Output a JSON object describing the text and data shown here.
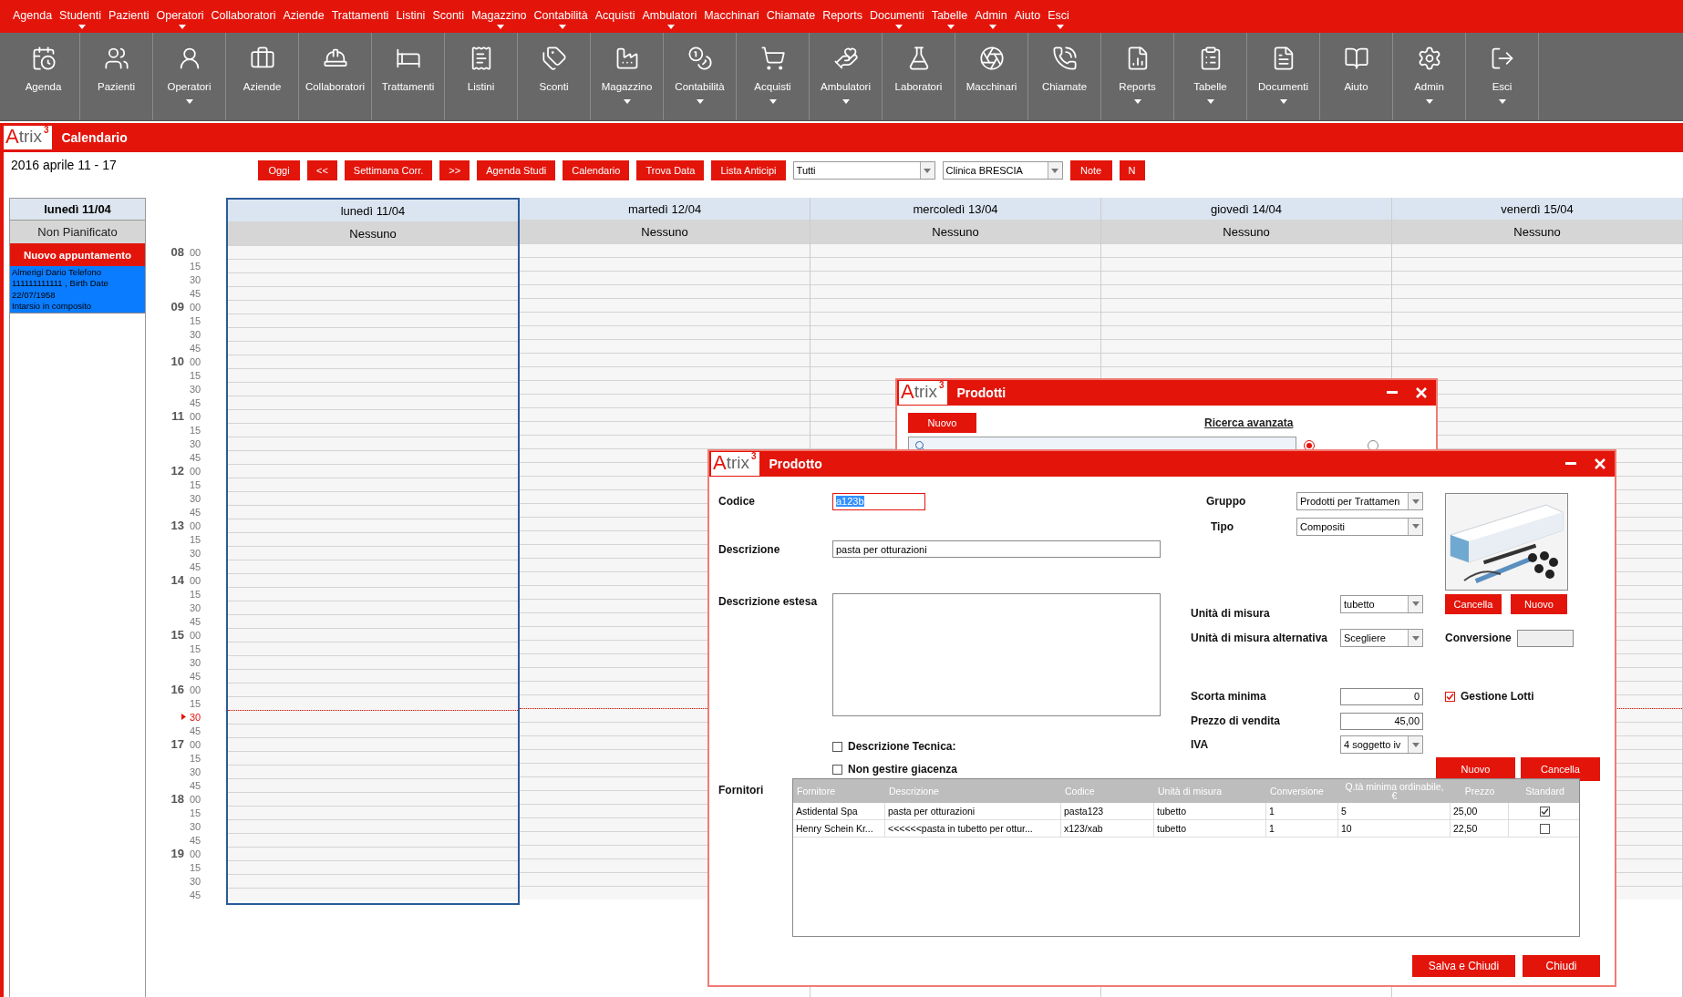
{
  "menu_bar": [
    {
      "label": "Agenda",
      "has_submenu": false
    },
    {
      "label": "Studenti",
      "has_submenu": true
    },
    {
      "label": "Pazienti",
      "has_submenu": false
    },
    {
      "label": "Operatori",
      "has_submenu": true
    },
    {
      "label": "Collaboratori",
      "has_submenu": false
    },
    {
      "label": "Aziende",
      "has_submenu": false
    },
    {
      "label": "Trattamenti",
      "has_submenu": false
    },
    {
      "label": "Listini",
      "has_submenu": false
    },
    {
      "label": "Sconti",
      "has_submenu": false
    },
    {
      "label": "Magazzino",
      "has_submenu": true
    },
    {
      "label": "Contabilità",
      "has_submenu": true
    },
    {
      "label": "Acquisti",
      "has_submenu": false
    },
    {
      "label": "Ambulatori",
      "has_submenu": true
    },
    {
      "label": "Macchinari",
      "has_submenu": false
    },
    {
      "label": "Chiamate",
      "has_submenu": false
    },
    {
      "label": "Reports",
      "has_submenu": false
    },
    {
      "label": "Documenti",
      "has_submenu": true
    },
    {
      "label": "Tabelle",
      "has_submenu": true
    },
    {
      "label": "Admin",
      "has_submenu": true
    },
    {
      "label": "Aiuto",
      "has_submenu": false
    },
    {
      "label": "Esci",
      "has_submenu": true
    }
  ],
  "toolbar": [
    {
      "label": "Agenda",
      "has_submenu": false
    },
    {
      "label": "Pazienti",
      "has_submenu": false
    },
    {
      "label": "Operatori",
      "has_submenu": true
    },
    {
      "label": "Aziende",
      "has_submenu": false
    },
    {
      "label": "Collaboratori",
      "has_submenu": false
    },
    {
      "label": "Trattamenti",
      "has_submenu": false
    },
    {
      "label": "Listini",
      "has_submenu": false
    },
    {
      "label": "Sconti",
      "has_submenu": false
    },
    {
      "label": "Magazzino",
      "has_submenu": true
    },
    {
      "label": "Contabilità",
      "has_submenu": true
    },
    {
      "label": "Acquisti",
      "has_submenu": true
    },
    {
      "label": "Ambulatori",
      "has_submenu": true
    },
    {
      "label": "Laboratori",
      "has_submenu": false
    },
    {
      "label": "Macchinari",
      "has_submenu": false
    },
    {
      "label": "Chiamate",
      "has_submenu": false
    },
    {
      "label": "Reports",
      "has_submenu": true
    },
    {
      "label": "Tabelle",
      "has_submenu": true
    },
    {
      "label": "Documenti",
      "has_submenu": true
    },
    {
      "label": "Aiuto",
      "has_submenu": false
    },
    {
      "label": "Admin",
      "has_submenu": true
    },
    {
      "label": "Esci",
      "has_submenu": true
    }
  ],
  "header": {
    "logo": {
      "letter": "A",
      "rest": "trix",
      "sup": "3"
    },
    "title": "Calendario"
  },
  "week_label": "2016 aprile 11 - 17",
  "actions": [
    {
      "kind": "button",
      "label": "Oggi"
    },
    {
      "kind": "button",
      "label": "<<"
    },
    {
      "kind": "button",
      "label": "Settimana Corr."
    },
    {
      "kind": "button",
      "label": ">>"
    },
    {
      "kind": "button",
      "label": "Agenda Studi"
    },
    {
      "kind": "button",
      "label": "Calendario"
    },
    {
      "kind": "button",
      "label": "Trova Data"
    },
    {
      "kind": "button",
      "label": "Lista Anticipi"
    },
    {
      "kind": "select",
      "value": "Tutti"
    },
    {
      "kind": "select",
      "value": "Clinica BRESCIA"
    },
    {
      "kind": "button",
      "label": "Note"
    },
    {
      "kind": "button",
      "label": "N"
    }
  ],
  "side_panel": {
    "day": "lunedì 11/04",
    "status": "Non Pianificato",
    "new_button": "Nuovo appuntamento",
    "appointments": [
      {
        "lines": [
          "Almerigi Dario   Telefono 111111111111 , Birth Date 22/07/1958",
          "Intarsio in composito"
        ]
      }
    ]
  },
  "calendar": {
    "days": [
      {
        "label": "lunedì 11/04",
        "status": "Nessuno",
        "selected": true
      },
      {
        "label": "martedì 12/04",
        "status": "Nessuno",
        "selected": false
      },
      {
        "label": "mercoledì 13/04",
        "status": "Nessuno",
        "selected": false
      },
      {
        "label": "giovedì 14/04",
        "status": "Nessuno",
        "selected": false
      },
      {
        "label": "venerdì 15/04",
        "status": "Nessuno",
        "selected": false
      }
    ],
    "hours": [
      {
        "hour": "08",
        "slots": [
          {
            "minute": "00",
            "current": false
          },
          {
            "minute": "15",
            "current": false
          },
          {
            "minute": "30",
            "current": false
          },
          {
            "minute": "45",
            "current": false
          }
        ]
      },
      {
        "hour": "09",
        "slots": [
          {
            "minute": "00",
            "current": false
          },
          {
            "minute": "15",
            "current": false
          },
          {
            "minute": "30",
            "current": false
          },
          {
            "minute": "45",
            "current": false
          }
        ]
      },
      {
        "hour": "10",
        "slots": [
          {
            "minute": "00",
            "current": false
          },
          {
            "minute": "15",
            "current": false
          },
          {
            "minute": "30",
            "current": false
          },
          {
            "minute": "45",
            "current": false
          }
        ]
      },
      {
        "hour": "11",
        "slots": [
          {
            "minute": "00",
            "current": false
          },
          {
            "minute": "15",
            "current": false
          },
          {
            "minute": "30",
            "current": false
          },
          {
            "minute": "45",
            "current": false
          }
        ]
      },
      {
        "hour": "12",
        "slots": [
          {
            "minute": "00",
            "current": false
          },
          {
            "minute": "15",
            "current": false
          },
          {
            "minute": "30",
            "current": false
          },
          {
            "minute": "45",
            "current": false
          }
        ]
      },
      {
        "hour": "13",
        "slots": [
          {
            "minute": "00",
            "current": false
          },
          {
            "minute": "15",
            "current": false
          },
          {
            "minute": "30",
            "current": false
          },
          {
            "minute": "45",
            "current": false
          }
        ]
      },
      {
        "hour": "14",
        "slots": [
          {
            "minute": "00",
            "current": false
          },
          {
            "minute": "15",
            "current": false
          },
          {
            "minute": "30",
            "current": false
          },
          {
            "minute": "45",
            "current": false
          }
        ]
      },
      {
        "hour": "15",
        "slots": [
          {
            "minute": "00",
            "current": false
          },
          {
            "minute": "15",
            "current": false
          },
          {
            "minute": "30",
            "current": false
          },
          {
            "minute": "45",
            "current": false
          }
        ]
      },
      {
        "hour": "16",
        "slots": [
          {
            "minute": "00",
            "current": false
          },
          {
            "minute": "15",
            "current": false
          },
          {
            "minute": "30",
            "current": true
          },
          {
            "minute": "45",
            "current": false
          }
        ]
      },
      {
        "hour": "17",
        "slots": [
          {
            "minute": "00",
            "current": false
          },
          {
            "minute": "15",
            "current": false
          },
          {
            "minute": "30",
            "current": false
          },
          {
            "minute": "45",
            "current": false
          }
        ]
      },
      {
        "hour": "18",
        "slots": [
          {
            "minute": "00",
            "current": false
          },
          {
            "minute": "15",
            "current": false
          },
          {
            "minute": "30",
            "current": false
          },
          {
            "minute": "45",
            "current": false
          }
        ]
      },
      {
        "hour": "19",
        "slots": [
          {
            "minute": "00",
            "current": false
          },
          {
            "minute": "15",
            "current": false
          },
          {
            "minute": "30",
            "current": false
          },
          {
            "minute": "45",
            "current": false
          }
        ]
      }
    ]
  },
  "products_window": {
    "logo": {
      "letter": "A",
      "rest": "trix",
      "sup": "3"
    },
    "title": "Prodotti",
    "new_button": "Nuovo",
    "advanced_search": "Ricerca avanzata",
    "match_options": [
      {
        "selected": true
      },
      {
        "selected": false
      }
    ]
  },
  "product_window": {
    "logo": {
      "letter": "A",
      "rest": "trix",
      "sup": "3"
    },
    "title": "Prodotto",
    "code": {
      "label": "Codice",
      "value": "a123b",
      "focused": true
    },
    "description": {
      "label": "Descrizione",
      "value": "pasta per otturazioni"
    },
    "extended_description": {
      "label": "Descrizione estesa"
    },
    "group": {
      "label": "Gruppo",
      "value": "Prodotti per Trattamen"
    },
    "type": {
      "label": "Tipo",
      "value": "Compositi"
    },
    "image_buttons": [
      "Cancella",
      "Nuovo"
    ],
    "unit": {
      "label": "Unità di misura",
      "value": "tubetto"
    },
    "alt_unit": {
      "label": "Unità di misura alternativa",
      "value": "Scegliere"
    },
    "conversion": {
      "label": "Conversione"
    },
    "min_stock": {
      "label": "Scorta minima",
      "value": "0"
    },
    "lots": {
      "label": "Gestione Lotti",
      "checked": true
    },
    "price": {
      "label": "Prezzo di vendita",
      "value": "45,00"
    },
    "vat": {
      "label": "IVA",
      "value": "4 soggetto iv"
    },
    "technical": {
      "label": "Descrizione Tecnica:",
      "checked": false
    },
    "no_stock": {
      "label": "Non gestire giacenza",
      "checked": false
    },
    "form_buttons": [
      "Nuovo",
      "Cancella"
    ],
    "suppliers": {
      "label": "Fornitori",
      "columns": [
        "Fornitore",
        "Descrizione",
        "Codice",
        "Unità di misura",
        "Conversione",
        "Q.tà minima ordinabile, €",
        "Prezzo",
        "Standard"
      ],
      "rows": [
        {
          "cells": [
            "Astidental Spa",
            "pasta per otturazioni",
            "pasta123",
            "tubetto",
            "1",
            "5",
            "25,00"
          ],
          "standard": true
        },
        {
          "cells": [
            "Henry Schein Kr...",
            "<<<<<<pasta in tubetto per ottur...",
            "x123/xab",
            "tubetto",
            "1",
            "10",
            "22,50"
          ],
          "standard": false
        }
      ]
    },
    "footer_buttons": [
      "Salva e Chiudi",
      "Chiudi"
    ]
  }
}
